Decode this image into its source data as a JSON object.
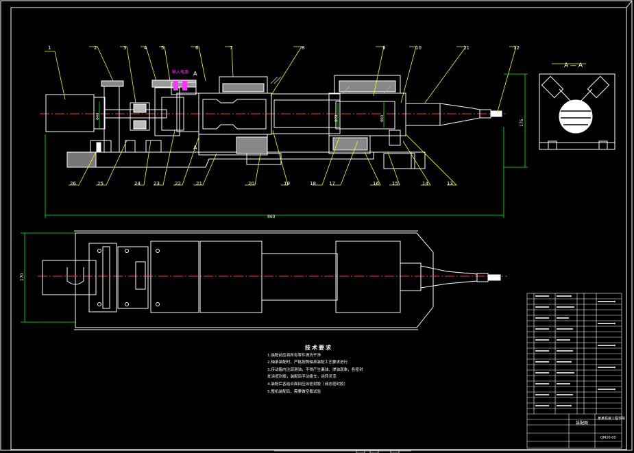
{
  "colors": {
    "background": "#000000",
    "frame": "#ffffff",
    "outline": "#ffffff",
    "leader": "#ffff00",
    "dimension": "#00ff00",
    "centerline": "#ff3333",
    "hatch": "#ffffff",
    "label": "#ffffff",
    "highlight": "#ff33ff"
  },
  "callouts_top": [
    "1",
    "2",
    "3",
    "4",
    "5",
    "6",
    "7",
    "8",
    "9",
    "10",
    "11",
    "12"
  ],
  "callouts_bottom": [
    "26",
    "25",
    "24",
    "23",
    "22",
    "21",
    "20",
    "19",
    "18",
    "17",
    "16",
    "15",
    "14",
    "13"
  ],
  "dimensions": {
    "overall_length": "860",
    "height_top": "175",
    "height_plan": "170",
    "dia_left": "Φ40",
    "dia_mid": "Φ70",
    "dia_right": "Φ60"
  },
  "markers": {
    "section_top": "A",
    "section_bottom": "A"
  },
  "section_view": {
    "title": "A — A"
  },
  "callout_note": "输入电源",
  "tech_notes": {
    "title": "技术要求",
    "lines": [
      "1.装配前应将所有零件清洗干净",
      "2.轴承装配时，严格按照轴承装配工艺要求进行",
      "3.传动箱内注润滑油，不得产生漏油、渗油现象，各密封",
      "  处涂密封胶，装配后手动盘车，运转灵活",
      "4.装配后各结合面间应涂密封胶（液态密封胶）",
      "5.整机装配后，需要做空载试验"
    ]
  },
  "title_block": {
    "drawing_title": "装配图",
    "school": "某某机械工程学院",
    "drawing_number": "QM20-00"
  }
}
